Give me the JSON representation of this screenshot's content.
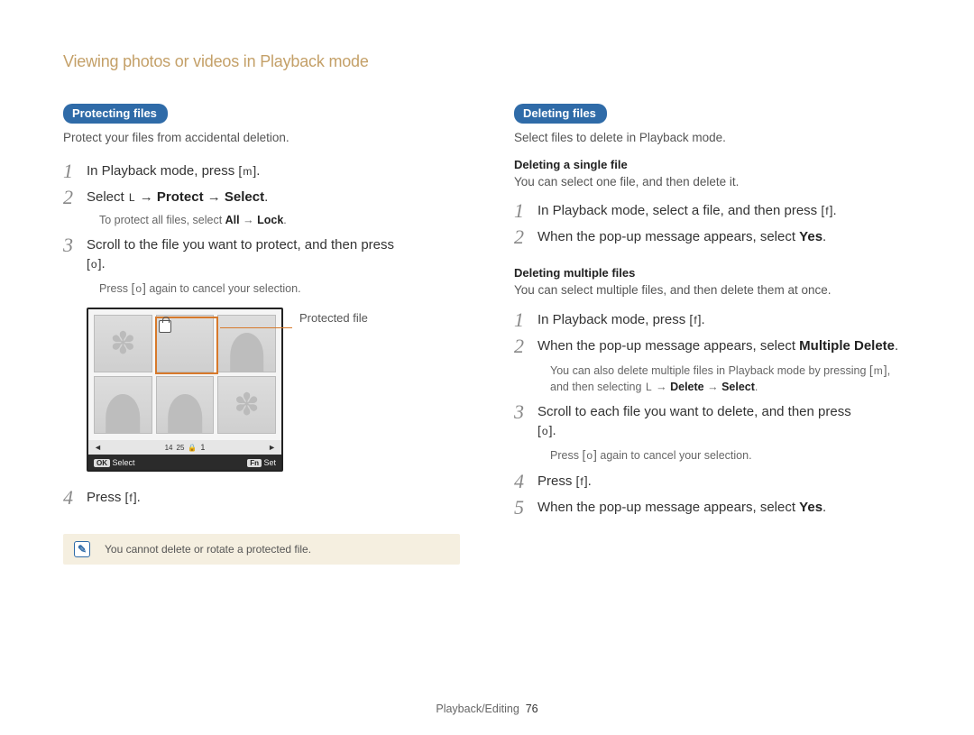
{
  "header": {
    "title": "Viewing photos or videos in Playback mode"
  },
  "left": {
    "pill": "Protecting files",
    "intro": "Protect your files from accidental deletion.",
    "step1": "In Playback mode, press ",
    "step1_btn": "m",
    "step1_tail": ".",
    "step2_pre": "Select ",
    "step2_icon": "L",
    "step2_arrow1": " → ",
    "step2_b1": "Protect",
    "step2_arrow2": " → ",
    "step2_b2": "Select",
    "step2_tail": ".",
    "step2_sub_pre": "To protect all files, select ",
    "step2_sub_b1": "All",
    "step2_sub_arrow": " → ",
    "step2_sub_b2": "Lock",
    "step2_sub_tail": ".",
    "step3_a": "Scroll to the ﬁle you want to protect, and then press ",
    "step3_btn": "o",
    "step3_tail": ".",
    "step3_sub_pre": "Press ",
    "step3_sub_btn": "o",
    "step3_sub_tail": " again to cancel your selection.",
    "callout": "Protected file",
    "screenshot": {
      "bar_left": "◄",
      "bar_mid_a": "14",
      "bar_mid_b": "25",
      "bar_lock": "⎋",
      "bar_num": "1",
      "bar_right": "►",
      "foot_ok": "OK",
      "foot_select": "Select",
      "foot_fn": "Fn",
      "foot_set": "Set"
    },
    "step4_pre": "Press ",
    "step4_btn": "f",
    "step4_tail": ".",
    "note": "You cannot delete or rotate a protected file."
  },
  "right": {
    "pill": "Deleting files",
    "intro": "Select files to delete in Playback mode.",
    "sub1": "Deleting a single file",
    "sub1_text": "You can select one file, and then delete it.",
    "s1_step1_a": "In Playback mode, select a ﬁle, and then press ",
    "s1_step1_btn": "f",
    "s1_step1_tail": ".",
    "s1_step2_a": "When the pop-up message appears, select ",
    "s1_step2_b": "Yes",
    "s1_step2_tail": ".",
    "sub2": "Deleting multiple files",
    "sub2_text": "You can select multiple files, and then delete them at once.",
    "s2_step1_a": "In Playback mode, press ",
    "s2_step1_btn": "f",
    "s2_step1_tail": ".",
    "s2_step2_a": "When the pop-up message appears, select ",
    "s2_step2_b": "Multiple Delete",
    "s2_step2_tail": ".",
    "s2_step2_sub_a": "You can also delete multiple files in Playback mode by pressing ",
    "s2_step2_sub_btn": "m",
    "s2_step2_sub_b": ", and then selecting ",
    "s2_step2_sub_icon": "L",
    "s2_step2_sub_arrow1": " → ",
    "s2_step2_sub_bold1": "Delete",
    "s2_step2_sub_arrow2": " → ",
    "s2_step2_sub_bold2": "Select",
    "s2_step2_sub_tail": ".",
    "s2_step3_a": "Scroll to each ﬁle you want to delete, and then press ",
    "s2_step3_btn": "o",
    "s2_step3_tail": ".",
    "s2_step3_sub_pre": "Press ",
    "s2_step3_sub_btn": "o",
    "s2_step3_sub_tail": " again to cancel your selection.",
    "s2_step4_pre": "Press ",
    "s2_step4_btn": "f",
    "s2_step4_tail": ".",
    "s2_step5_a": "When the pop-up message appears, select ",
    "s2_step5_b": "Yes",
    "s2_step5_tail": "."
  },
  "footer": {
    "section": "Playback/Editing",
    "page": "76"
  }
}
